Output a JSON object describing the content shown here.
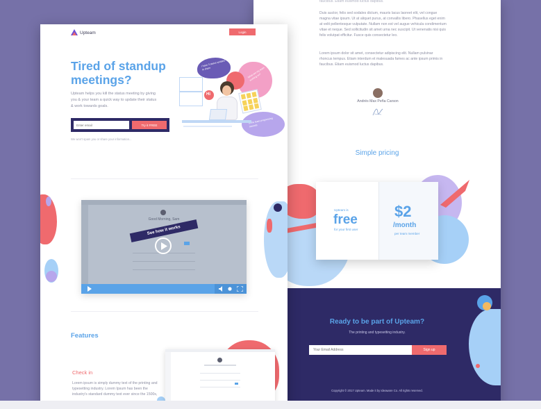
{
  "brand": {
    "name": "Upteam"
  },
  "nav": {
    "login": "Login"
  },
  "hero": {
    "title_line1": "Tired of standup",
    "title_line2": "meetings?",
    "desc_line1": "Upteam helps you kill the status meeting by giving",
    "desc_line2": "you & your team a quick way to update their status",
    "desc_line3": "& work towards goals.",
    "email_placeholder": "Enter email",
    "cta": "Try it FREE",
    "note": "We won't spam you or share your information..."
  },
  "illustration": {
    "hi": "Hi",
    "bubble1": "I have 3 status updates to share",
    "bubble2": "What are my team working on?",
    "bubble3": "Is the team progressing towards"
  },
  "video": {
    "greeting": "Good Morning, Sam",
    "ribbon": "See how it works"
  },
  "features": {
    "title": "Features",
    "checkin_title": "Check in",
    "checkin_line1": "Lorem ipsum is simply dummy text of the printing and",
    "checkin_line2": "typesetting industry. Lorem Ipsum has been the",
    "checkin_line3": "industry's standard dummy text ever since the 1500s,"
  },
  "testimonial": {
    "para1_line1": "Duis auctor, felis sed sodales dictum, mauris lacus laoreet elit, vel congue",
    "para1_line2": "magna vitae ipsum. Ut at aliquet purus, at convallis libero. Phasellus eget enim",
    "para1_line3": "at velit pellentesque vulputate. Nullam non est vel augue vehicula condimentum",
    "para1_line4": "vitae et neque. Sed sollicitudin sit amet urna nec suscipit. Ut venenatis nisi quis",
    "para1_line5": "felis volutpat efficitur. Fusce quis consectetur leo.",
    "para2_line1": "Lorem ipsum dolor sit amet, consectetur adipiscing elit. Nullam pulvinar",
    "para2_line2": "rhoncus tempus. Etiam interdum et malesuada fames ac ante ipsum primis in",
    "para2_line3": "faucibus. Etiam euismod luctus dapibus.",
    "author": "Andrés Max Peña Carson"
  },
  "pricing": {
    "title": "Simple pricing",
    "free_pre": "Upteam is",
    "free_big": "free",
    "free_post": "for your first user",
    "price_big": "$2",
    "price_unit": "/month",
    "price_post": "per team member"
  },
  "cta_section": {
    "title": "Ready to be part of Upteam?",
    "subtitle": "The printing and typesetting industry.",
    "email_placeholder": "Your Email Address",
    "button": "Sign up",
    "copyright": "Copyright © 2017 Upteam. Made it by Ideaware Co. All rights reserved."
  },
  "colors": {
    "accent": "#ef6a6e",
    "blue": "#5aa3e8",
    "navy": "#2e2a66",
    "background": "#7671a8"
  }
}
